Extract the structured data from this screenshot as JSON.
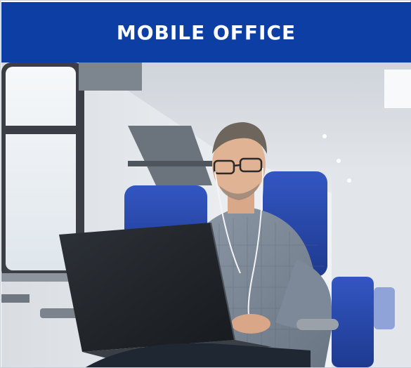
{
  "banner": {
    "title": "MOBILE OFFICE",
    "background_color": "#0c3ea4",
    "text_color": "#ffffff"
  },
  "photo": {
    "subject": "man-working-on-laptop-in-train",
    "accent_seat_color": "#2c4fb8"
  }
}
